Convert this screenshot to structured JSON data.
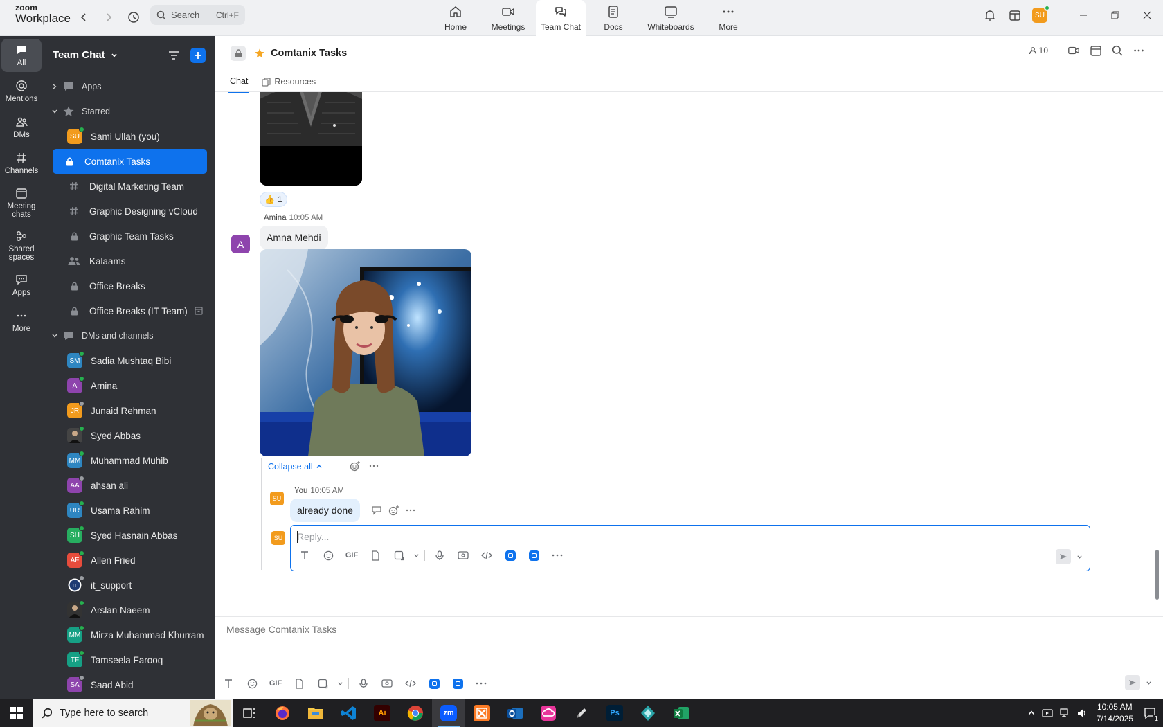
{
  "app": {
    "brand_line1": "zoom",
    "brand_line2": "Workplace"
  },
  "search": {
    "placeholder": "Search",
    "shortcut": "Ctrl+F"
  },
  "nav_tabs": [
    {
      "label": "Home",
      "icon": "home-icon"
    },
    {
      "label": "Meetings",
      "icon": "video-camera-icon"
    },
    {
      "label": "Team Chat",
      "icon": "chat-bubbles-icon",
      "active": true
    },
    {
      "label": "Docs",
      "icon": "document-icon"
    },
    {
      "label": "Whiteboards",
      "icon": "whiteboard-icon"
    },
    {
      "label": "More",
      "icon": "ellipsis-icon"
    }
  ],
  "user": {
    "initials": "SU",
    "color": "#f29b1d"
  },
  "rail": [
    {
      "label": "All",
      "icon": "chat-icon",
      "active": true
    },
    {
      "label": "Mentions",
      "icon": "at-sign-icon"
    },
    {
      "label": "DMs",
      "icon": "people-icon"
    },
    {
      "label": "Channels",
      "icon": "hash-icon"
    },
    {
      "label": "Meeting chats",
      "icon": "calendar-icon"
    },
    {
      "label": "Shared spaces",
      "icon": "shared-spaces-icon"
    },
    {
      "label": "Apps",
      "icon": "apps-chat-icon"
    },
    {
      "label": "More",
      "icon": "more-dots-icon"
    }
  ],
  "sidebar": {
    "title": "Team Chat",
    "apps_label": "Apps",
    "starred_label": "Starred",
    "starred": [
      {
        "label": "Sami Ullah (you)",
        "type": "avatar",
        "initials": "SU",
        "color": "#f29b1d",
        "online": true
      },
      {
        "label": "Comtanix Tasks",
        "type": "lock",
        "selected": true
      },
      {
        "label": "Digital Marketing Team",
        "type": "hash"
      },
      {
        "label": "Graphic Designing vCloud",
        "type": "hash"
      },
      {
        "label": "Graphic Team Tasks",
        "type": "lock"
      },
      {
        "label": "Kalaams",
        "type": "group"
      },
      {
        "label": "Office Breaks",
        "type": "lock"
      },
      {
        "label": "Office Breaks (IT Team)",
        "type": "lock",
        "archived": true
      }
    ],
    "dms_label": "DMs and channels",
    "dms": [
      {
        "label": "Sadia Mushtaq Bibi",
        "initials": "SM",
        "color": "#2e86c1",
        "online": true
      },
      {
        "label": "Amina",
        "initials": "A",
        "color": "#8e44ad",
        "online": true
      },
      {
        "label": "Junaid Rehman",
        "initials": "JR",
        "color": "#f29b1d",
        "online": false
      },
      {
        "label": "Syed Abbas",
        "initials": "",
        "color": "#444",
        "online": true,
        "photo": true
      },
      {
        "label": "Muhammad Muhib",
        "initials": "MM",
        "color": "#2e86c1",
        "online": true
      },
      {
        "label": "ahsan ali",
        "initials": "AA",
        "color": "#8e44ad",
        "online": false
      },
      {
        "label": "Usama Rahim",
        "initials": "UR",
        "color": "#2e86c1",
        "online": true
      },
      {
        "label": "Syed Hasnain Abbas",
        "initials": "SH",
        "color": "#27ae60",
        "online": true
      },
      {
        "label": "Allen Fried",
        "initials": "AF",
        "color": "#e74c3c",
        "online": true
      },
      {
        "label": "it_support",
        "initials": "IT",
        "color": "#1f3b73",
        "online": false,
        "ring": true
      },
      {
        "label": "Arslan Naeem",
        "initials": "",
        "color": "#333",
        "online": true,
        "photo": true
      },
      {
        "label": "Mirza Muhammad Khurram",
        "initials": "MM",
        "color": "#16a085",
        "online": true
      },
      {
        "label": "Tamseela Farooq",
        "initials": "TF",
        "color": "#16a085",
        "online": true
      },
      {
        "label": "Saad Abid",
        "initials": "SA",
        "color": "#8e44ad",
        "online": false
      }
    ]
  },
  "channel": {
    "name": "Comtanix Tasks",
    "member_count": "10",
    "tabs": [
      "Chat",
      "Resources"
    ]
  },
  "messages": {
    "reaction": {
      "emoji": "👍",
      "count": "1"
    },
    "amina": {
      "author": "Amina",
      "time": "10:05 AM",
      "avatar": "A",
      "text": "Amna Mehdi"
    },
    "collapse_label": "Collapse all",
    "reply": {
      "author": "You",
      "time": "10:05 AM",
      "avatar": "SU",
      "text": "already done"
    },
    "reply_placeholder": "Reply..."
  },
  "composer": {
    "placeholder": "Message Comtanix Tasks",
    "gif_label": "GIF"
  },
  "taskbar": {
    "search_placeholder": "Type here to search",
    "apps": [
      "task-view-icon",
      "firefox-icon",
      "file-explorer-icon",
      "vscode-icon",
      "illustrator-icon",
      "chrome-icon",
      "zoom-icon",
      "xampp-icon",
      "outlook-icon",
      "creative-cloud-icon",
      "pen-icon",
      "photoshop-icon",
      "app-icon",
      "excel-icon"
    ],
    "app_labels": {
      "ai": "Ai",
      "zm": "zm",
      "ps": "Ps"
    },
    "time": "10:05 AM",
    "date": "7/14/2025",
    "notif_count": "1"
  }
}
